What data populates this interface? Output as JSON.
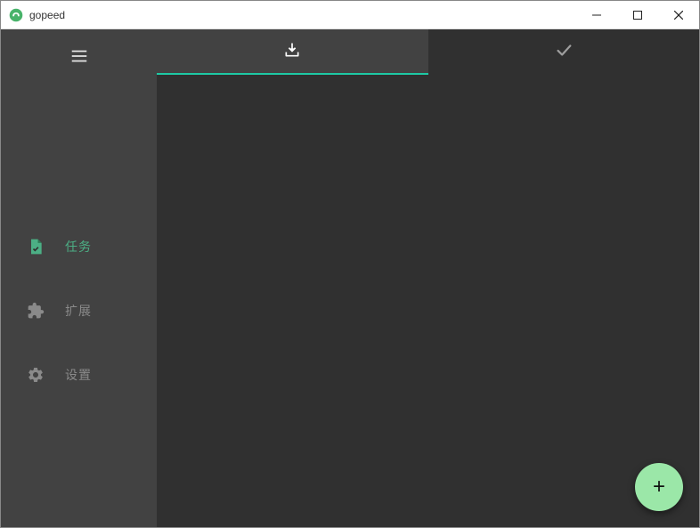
{
  "window": {
    "title": "gopeed"
  },
  "sidebar": {
    "items": [
      {
        "label": "任务"
      },
      {
        "label": "扩展"
      },
      {
        "label": "设置"
      }
    ]
  },
  "tabs": {
    "downloading_tooltip": "下载中",
    "completed_tooltip": "已完成"
  }
}
